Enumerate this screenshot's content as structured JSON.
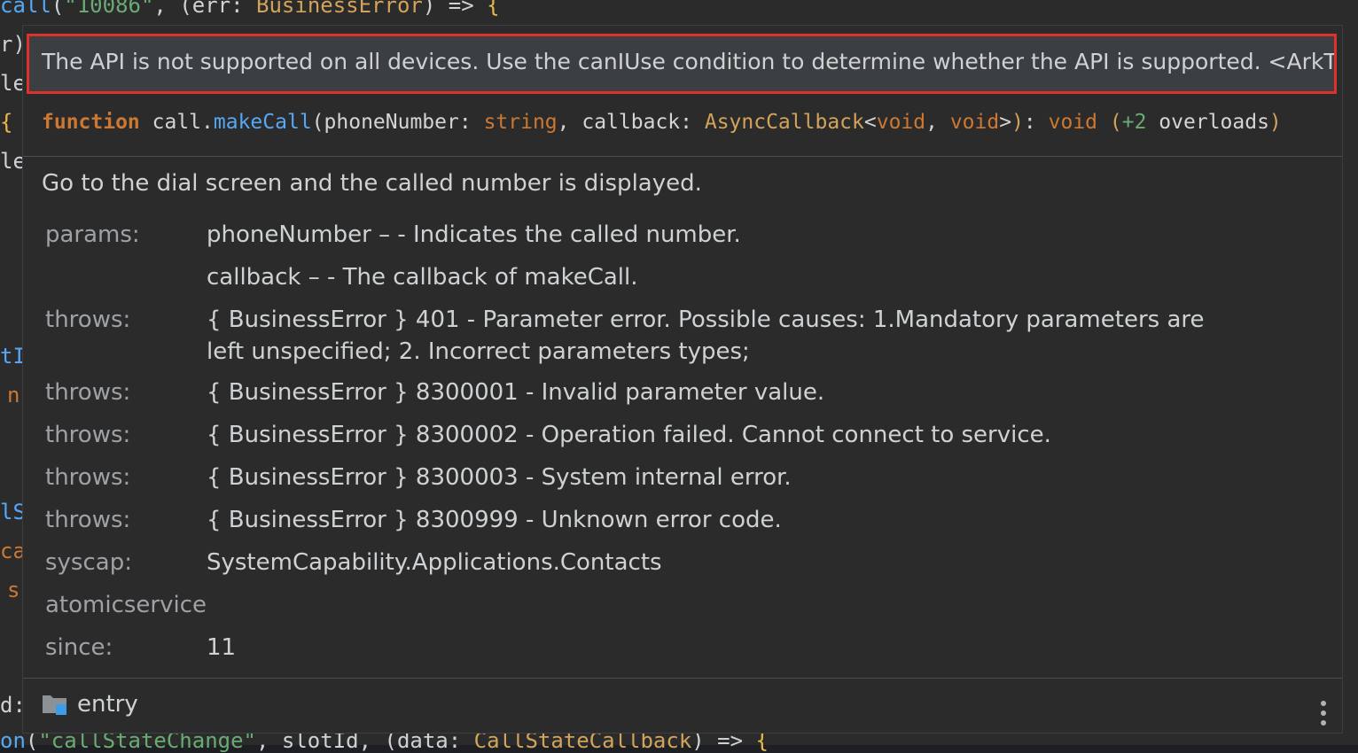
{
  "editor": {
    "top_line": "call(\"10086\", (err: BusinessError) => {",
    "bottom_line": "on(\"callStateChange\", slotId, (data: CallStateCallback) => {",
    "gutter_fragments": [
      ")",
      "le",
      "{",
      "le",
      "√",
      "tI",
      "n",
      "lS",
      "ca",
      "s",
      "d:"
    ]
  },
  "popup": {
    "warning": "The API is not supported on all devices. Use the canIUse condition to determine whether the API is supported. <ArkTSCheck>",
    "signature": {
      "keyword": "function",
      "object": "call.",
      "method": "makeCall",
      "param1_name": "phoneNumber",
      "param1_type": "string",
      "param2_name": "callback",
      "param2_type": "AsyncCallback",
      "generic1": "void",
      "generic2": "void",
      "return_type": "void",
      "overloads_count": "+2",
      "overloads_word": "overloads"
    },
    "description": "Go to the dial screen and the called number is displayed.",
    "rows": [
      {
        "label": "params:",
        "value": "phoneNumber – - Indicates the called number."
      },
      {
        "label": "",
        "value": "callback – - The callback of makeCall."
      },
      {
        "label": "throws:",
        "value": "{ BusinessError } 401 - Parameter error. Possible causes: 1.Mandatory parameters are left unspecified; 2. Incorrect parameters types;"
      },
      {
        "label": "throws:",
        "value": "{ BusinessError } 8300001 - Invalid parameter value."
      },
      {
        "label": "throws:",
        "value": "{ BusinessError } 8300002 - Operation failed. Cannot connect to service."
      },
      {
        "label": "throws:",
        "value": "{ BusinessError } 8300003 - System internal error."
      },
      {
        "label": "throws:",
        "value": "{ BusinessError } 8300999 - Unknown error code."
      },
      {
        "label": "syscap:",
        "value": "SystemCapability.Applications.Contacts"
      },
      {
        "label": "atomicservice",
        "value": ""
      },
      {
        "label": "since:",
        "value": "11"
      }
    ],
    "footer": {
      "module": "entry",
      "module_icon": "folder-module-icon",
      "more_icon": "more-vertical-icon"
    }
  },
  "colors": {
    "warning_border": "#e0302b",
    "keyword": "#cc7832",
    "method": "#56a8f5",
    "type": "#d4a35a"
  }
}
